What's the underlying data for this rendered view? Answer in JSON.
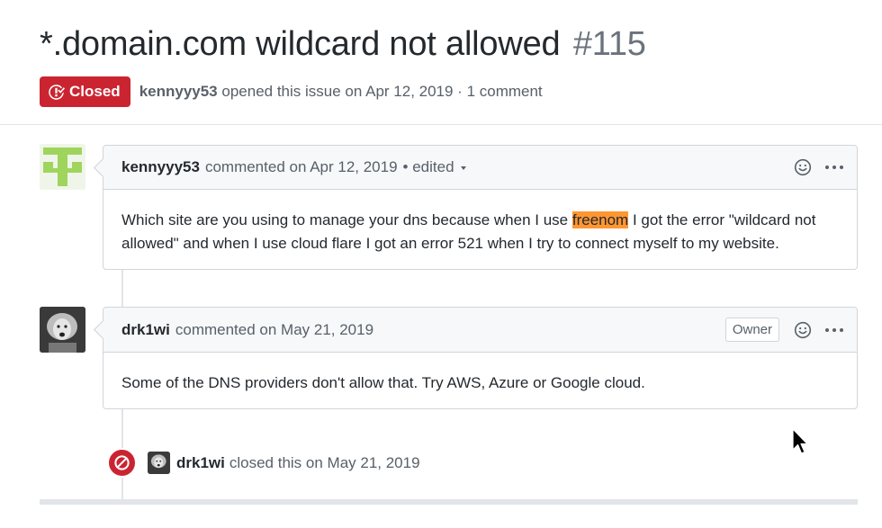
{
  "issue": {
    "title": "*.domain.com wildcard not allowed",
    "number": "#115",
    "state": "Closed",
    "author": "kennyyy53",
    "meta_text": "opened this issue on Apr 12, 2019 · 1 comment"
  },
  "comments": [
    {
      "author": "kennyyy53",
      "action": "commented on Apr 12, 2019",
      "edited": "• edited",
      "body_before": "Which site are you using to manage your dns because when I use ",
      "body_highlight": "freenom",
      "body_after": " I got the error \"wildcard not allowed\" and when I use cloud flare I got an error 521 when I try to connect myself to my website."
    },
    {
      "author": "drk1wi",
      "action": "commented on May 21, 2019",
      "badge": "Owner",
      "body": "Some of the DNS providers don't allow that. Try AWS, Azure or Google cloud."
    }
  ],
  "event": {
    "actor": "drk1wi",
    "text": "closed this on May 21, 2019",
    "icon": "circle-slash-icon"
  },
  "icons": {
    "state": "issue-closed-icon",
    "reaction": "smiley-icon",
    "more": "kebab-horizontal-icon"
  },
  "colors": {
    "closed_red": "#cb2431",
    "highlight": "#ff9632",
    "muted": "#586069",
    "border": "#d1d5da"
  }
}
